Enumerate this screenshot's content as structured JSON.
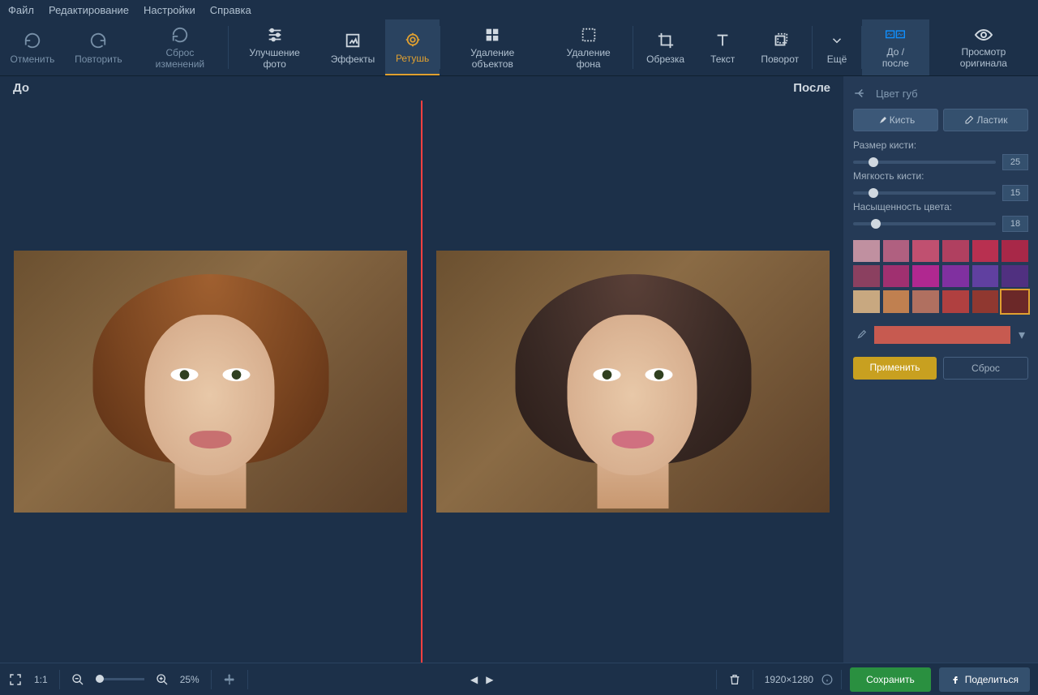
{
  "menu": {
    "file": "Файл",
    "edit": "Редактирование",
    "settings": "Настройки",
    "help": "Справка"
  },
  "toolbar": {
    "undo": "Отменить",
    "redo": "Повторить",
    "reset": "Сброс изменений",
    "enhance": "Улучшение фото",
    "effects": "Эффекты",
    "retouch": "Ретушь",
    "removeObj": "Удаление объектов",
    "removeBg": "Удаление фона",
    "crop": "Обрезка",
    "text": "Текст",
    "rotate": "Поворот",
    "more": "Ещё",
    "beforeAfter": "До / после",
    "viewOriginal": "Просмотр оригинала"
  },
  "canvas": {
    "before": "До",
    "after": "После"
  },
  "panel": {
    "title": "Цвет губ",
    "brush": "Кисть",
    "eraser": "Ластик",
    "sliders": [
      {
        "label": "Размер кисти:",
        "value": "25",
        "pos": 14
      },
      {
        "label": "Мягкость кисти:",
        "value": "15",
        "pos": 14
      },
      {
        "label": "Насыщенность цвета:",
        "value": "18",
        "pos": 16
      }
    ],
    "palette": [
      "#c090a0",
      "#b06080",
      "#c05070",
      "#b04060",
      "#b83050",
      "#a82848",
      "#8b4060",
      "#a03070",
      "#b02890",
      "#8030a0",
      "#6040a0",
      "#503080",
      "#c8a880",
      "#c08050",
      "#b07060",
      "#b04040",
      "#903830",
      "#6b2828"
    ],
    "selectedIndex": 17,
    "pickedColor": "#c75a50",
    "apply": "Применить",
    "resetBtn": "Сброс"
  },
  "status": {
    "oneToOne": "1:1",
    "zoom": "25%",
    "dimensions": "1920×1280",
    "save": "Сохранить",
    "share": "Поделиться"
  }
}
